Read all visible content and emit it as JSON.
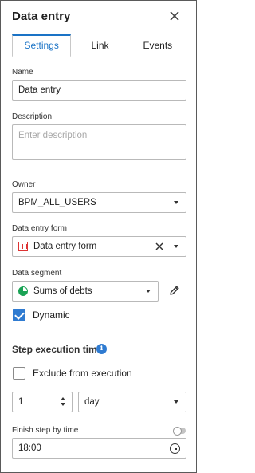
{
  "header": {
    "title": "Data entry",
    "close_icon": "close-icon"
  },
  "tabs": [
    {
      "label": "Settings",
      "active": true
    },
    {
      "label": "Link",
      "active": false
    },
    {
      "label": "Events",
      "active": false
    }
  ],
  "name": {
    "label": "Name",
    "value": "Data entry"
  },
  "description": {
    "label": "Description",
    "placeholder": "Enter description",
    "value": ""
  },
  "owner": {
    "label": "Owner",
    "value": "BPM_ALL_USERS"
  },
  "data_entry_form": {
    "label": "Data entry form",
    "value": "Data entry form",
    "icon": "form-icon"
  },
  "data_segment": {
    "label": "Data segment",
    "value": "Sums of debts",
    "icon": "pie-chart-icon",
    "edit_icon": "pencil-icon"
  },
  "dynamic": {
    "label": "Dynamic",
    "checked": true
  },
  "step_execution": {
    "title": "Step execution time",
    "info_glyph": "i",
    "exclude": {
      "label": "Exclude from execution",
      "checked": false
    },
    "count": "1",
    "unit": "day"
  },
  "finish_step": {
    "label": "Finish step by time",
    "enabled": false,
    "time": "18:00"
  },
  "colors": {
    "accent": "#1a73c6",
    "checkbox": "#2f7bd1",
    "form_icon": "#dd3333",
    "segment_icon": "#1aa355"
  }
}
